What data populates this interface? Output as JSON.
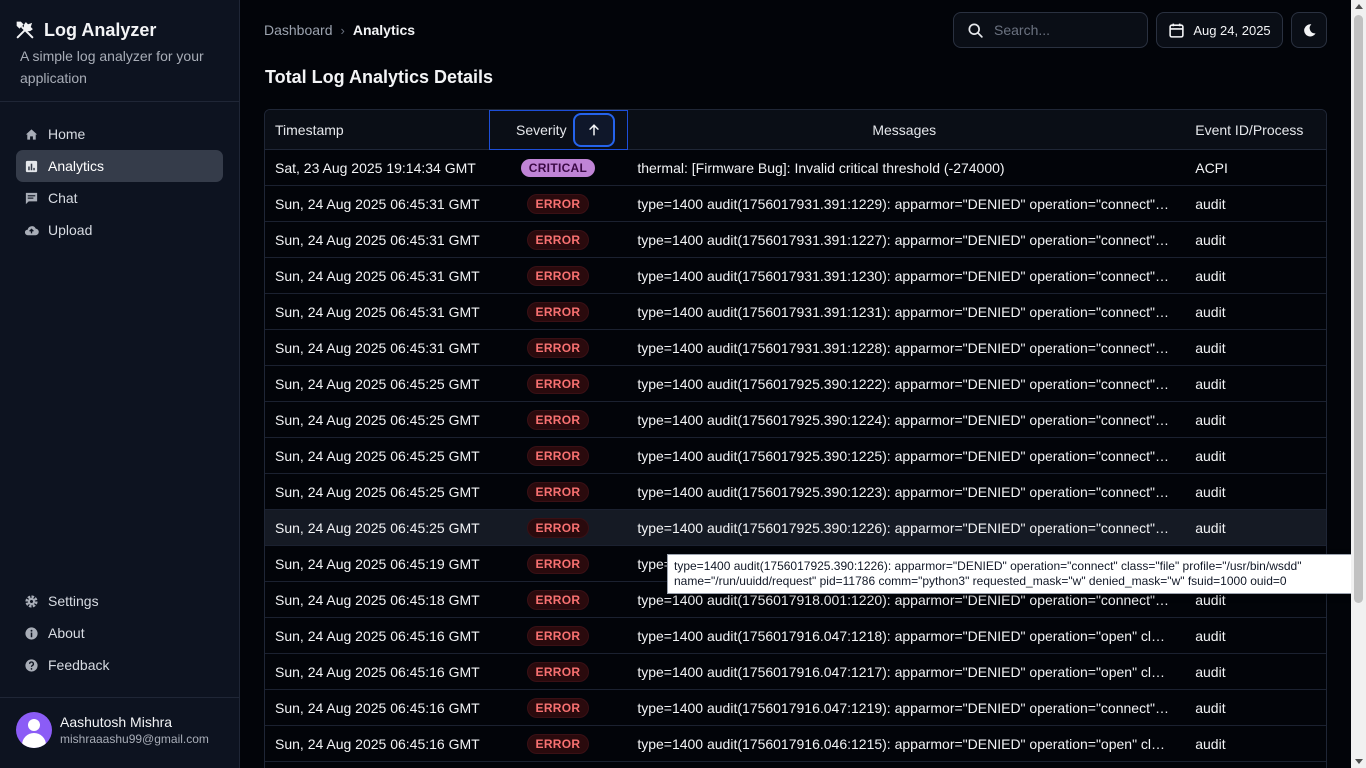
{
  "sidebar": {
    "brand_title": "Log Analyzer",
    "brand_subtitle": "A simple log analyzer for your application",
    "nav": [
      {
        "label": "Home",
        "icon": "home-icon"
      },
      {
        "label": "Analytics",
        "icon": "chart-icon",
        "active": true
      },
      {
        "label": "Chat",
        "icon": "chat-icon"
      },
      {
        "label": "Upload",
        "icon": "cloud-upload-icon"
      }
    ],
    "bottom_nav": [
      {
        "label": "Settings",
        "icon": "gear-icon"
      },
      {
        "label": "About",
        "icon": "info-icon"
      },
      {
        "label": "Feedback",
        "icon": "help-icon"
      }
    ],
    "user": {
      "name": "Aashutosh Mishra",
      "email": "mishraaashu99@gmail.com"
    }
  },
  "header": {
    "breadcrumb": [
      "Dashboard",
      "Analytics"
    ],
    "search_placeholder": "Search...",
    "date": "Aug 24, 2025"
  },
  "page_title": "Total Log Analytics Details",
  "table": {
    "columns": [
      "Timestamp",
      "Severity",
      "Messages",
      "Event ID/Process"
    ],
    "rows": [
      {
        "timestamp": "Sat, 23 Aug 2025 19:14:34 GMT",
        "severity": "CRITICAL",
        "message": "thermal: [Firmware Bug]: Invalid critical threshold (-274000)",
        "event": "ACPI"
      },
      {
        "timestamp": "Sun, 24 Aug 2025 06:45:31 GMT",
        "severity": "ERROR",
        "message": "type=1400 audit(1756017931.391:1229): apparmor=\"DENIED\" operation=\"connect\" class=\"file\"",
        "event": "audit"
      },
      {
        "timestamp": "Sun, 24 Aug 2025 06:45:31 GMT",
        "severity": "ERROR",
        "message": "type=1400 audit(1756017931.391:1227): apparmor=\"DENIED\" operation=\"connect\" class=\"file\"",
        "event": "audit"
      },
      {
        "timestamp": "Sun, 24 Aug 2025 06:45:31 GMT",
        "severity": "ERROR",
        "message": "type=1400 audit(1756017931.391:1230): apparmor=\"DENIED\" operation=\"connect\" class=\"file\"",
        "event": "audit"
      },
      {
        "timestamp": "Sun, 24 Aug 2025 06:45:31 GMT",
        "severity": "ERROR",
        "message": "type=1400 audit(1756017931.391:1231): apparmor=\"DENIED\" operation=\"connect\" class=\"file\"",
        "event": "audit"
      },
      {
        "timestamp": "Sun, 24 Aug 2025 06:45:31 GMT",
        "severity": "ERROR",
        "message": "type=1400 audit(1756017931.391:1228): apparmor=\"DENIED\" operation=\"connect\" class=\"file\"",
        "event": "audit"
      },
      {
        "timestamp": "Sun, 24 Aug 2025 06:45:25 GMT",
        "severity": "ERROR",
        "message": "type=1400 audit(1756017925.390:1222): apparmor=\"DENIED\" operation=\"connect\" class=\"file\"",
        "event": "audit"
      },
      {
        "timestamp": "Sun, 24 Aug 2025 06:45:25 GMT",
        "severity": "ERROR",
        "message": "type=1400 audit(1756017925.390:1224): apparmor=\"DENIED\" operation=\"connect\" class=\"file\"",
        "event": "audit"
      },
      {
        "timestamp": "Sun, 24 Aug 2025 06:45:25 GMT",
        "severity": "ERROR",
        "message": "type=1400 audit(1756017925.390:1225): apparmor=\"DENIED\" operation=\"connect\" class=\"file\"",
        "event": "audit"
      },
      {
        "timestamp": "Sun, 24 Aug 2025 06:45:25 GMT",
        "severity": "ERROR",
        "message": "type=1400 audit(1756017925.390:1223): apparmor=\"DENIED\" operation=\"connect\" class=\"file\"",
        "event": "audit"
      },
      {
        "timestamp": "Sun, 24 Aug 2025 06:45:25 GMT",
        "severity": "ERROR",
        "message": "type=1400 audit(1756017925.390:1226): apparmor=\"DENIED\" operation=\"connect\" class=\"file\"",
        "event": "audit",
        "hover": true
      },
      {
        "timestamp": "Sun, 24 Aug 2025 06:45:19 GMT",
        "severity": "ERROR",
        "message": "type=1400 audit(1756017919.002:1221): apparmor=\"DENIED\" operation=\"connect\" class=\"file\"",
        "event": "audit"
      },
      {
        "timestamp": "Sun, 24 Aug 2025 06:45:18 GMT",
        "severity": "ERROR",
        "message": "type=1400 audit(1756017918.001:1220): apparmor=\"DENIED\" operation=\"connect\" class=\"file\"",
        "event": "audit"
      },
      {
        "timestamp": "Sun, 24 Aug 2025 06:45:16 GMT",
        "severity": "ERROR",
        "message": "type=1400 audit(1756017916.047:1218): apparmor=\"DENIED\" operation=\"open\" class=\"file\"",
        "event": "audit"
      },
      {
        "timestamp": "Sun, 24 Aug 2025 06:45:16 GMT",
        "severity": "ERROR",
        "message": "type=1400 audit(1756017916.047:1217): apparmor=\"DENIED\" operation=\"open\" class=\"file\"",
        "event": "audit"
      },
      {
        "timestamp": "Sun, 24 Aug 2025 06:45:16 GMT",
        "severity": "ERROR",
        "message": "type=1400 audit(1756017916.047:1219): apparmor=\"DENIED\" operation=\"connect\" class=\"file\"",
        "event": "audit"
      },
      {
        "timestamp": "Sun, 24 Aug 2025 06:45:16 GMT",
        "severity": "ERROR",
        "message": "type=1400 audit(1756017916.046:1215): apparmor=\"DENIED\" operation=\"open\" class=\"file\"",
        "event": "audit"
      }
    ]
  },
  "tooltip": "type=1400 audit(1756017925.390:1226): apparmor=\"DENIED\" operation=\"connect\" class=\"file\" profile=\"/usr/bin/wsdd\" name=\"/run/uuidd/request\" pid=11786 comm=\"python3\" requested_mask=\"w\" denied_mask=\"w\" fsuid=1000 ouid=0",
  "colors": {
    "accent": "#2563eb",
    "critical": "#c084d6",
    "error": "#f87171",
    "sidebar_bg": "#0d1320",
    "page_bg": "#020409"
  }
}
